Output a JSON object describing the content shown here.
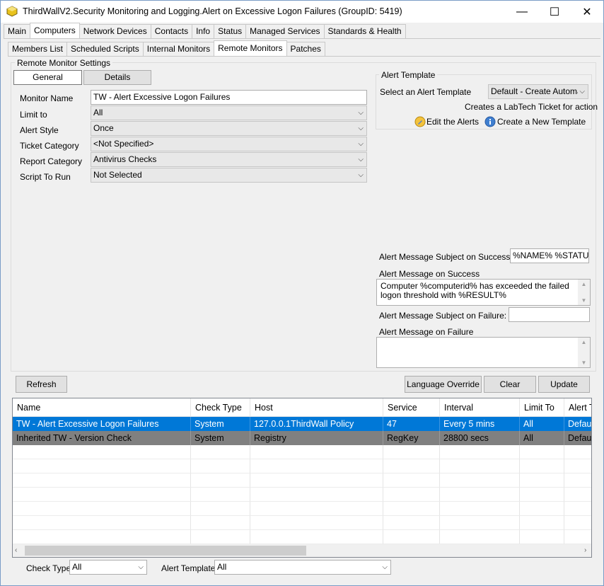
{
  "window": {
    "title": "ThirdWallV2.Security Monitoring and Logging.Alert on Excessive Logon Failures    (GroupID: 5419)",
    "minimize": "—",
    "maximize": "☐",
    "close": "✕"
  },
  "main_tabs": [
    "Main",
    "Computers",
    "Network Devices",
    "Contacts",
    "Info",
    "Status",
    "Managed Services",
    "Standards & Health"
  ],
  "sub_tabs": [
    "Members List",
    "Scheduled Scripts",
    "Internal Monitors",
    "Remote Monitors",
    "Patches"
  ],
  "settings": {
    "group_label": "Remote Monitor Settings",
    "tab_general": "General",
    "tab_details": "Details",
    "monitor_name_label": "Monitor Name",
    "monitor_name_value": "TW - Alert Excessive Logon Failures",
    "limit_to_label": "Limit to",
    "limit_to_value": "All",
    "alert_style_label": "Alert Style",
    "alert_style_value": "Once",
    "ticket_category_label": "Ticket Category",
    "ticket_category_value": "<Not Specified>",
    "report_category_label": "Report Category",
    "report_category_value": "Antivirus Checks",
    "script_label": "Script To Run",
    "script_value": "Not Selected"
  },
  "alert_template": {
    "group_label": "Alert Template",
    "select_label": "Select an Alert Template",
    "select_value": "Default - Create Automa",
    "description": "Creates a LabTech Ticket for action",
    "edit_link": "Edit the Alerts",
    "create_link": "Create a New Template"
  },
  "messages": {
    "subject_success_label": "Alert Message Subject on Success:",
    "subject_success_value": "%NAME% %STATUS%",
    "success_label": "Alert Message on Success",
    "success_value": "Computer %computerid% has exceeded the failed logon threshold with %RESULT%",
    "subject_failure_label": "Alert Message Subject on Failure:",
    "subject_failure_value": "",
    "failure_label": "Alert Message on Failure",
    "failure_value": ""
  },
  "buttons": {
    "refresh": "Refresh",
    "language_override": "Language Override",
    "clear": "Clear",
    "update": "Update"
  },
  "grid": {
    "columns": [
      "Name",
      "Check Type",
      "Host",
      "Service",
      "Interval",
      "Limit To",
      "Alert T"
    ],
    "rows": [
      [
        "TW - Alert Excessive Logon Failures",
        "System",
        "127.0.0.1ThirdWall Policy",
        "47",
        "Every 5 mins",
        "All",
        "Default"
      ],
      [
        "Inherited TW - Version Check",
        "System",
        "Registry",
        "RegKey",
        "28800 secs",
        "All",
        "Default"
      ]
    ]
  },
  "filters": {
    "check_type_label": "Check Type",
    "check_type_value": "All",
    "alert_template_label": "Alert Template",
    "alert_template_value": "All"
  },
  "colors": {
    "selected_row": "#0078d7",
    "inherited_row": "#808080"
  }
}
